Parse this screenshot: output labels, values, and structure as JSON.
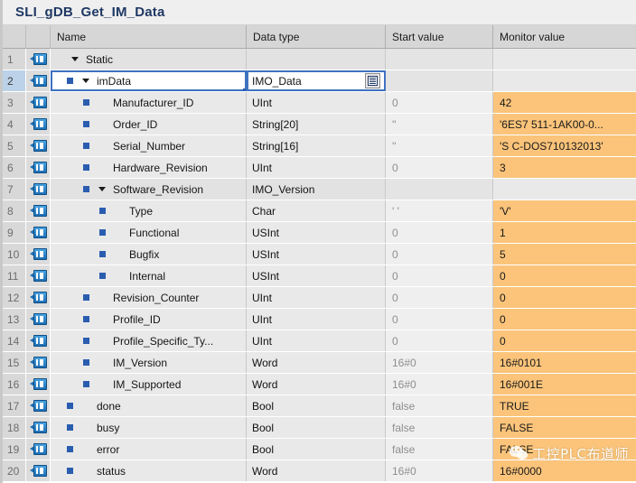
{
  "window": {
    "title": "SLI_gDB_Get_IM_Data"
  },
  "table": {
    "columns": {
      "number": "",
      "icon": "",
      "name": "Name",
      "data_type": "Data type",
      "start_value": "Start value",
      "monitor_value": "Monitor value"
    },
    "rows": [
      {
        "num": "1",
        "indent": 0,
        "expander": "down",
        "marker": false,
        "name": "Static",
        "type": "",
        "start": "",
        "monitor": "",
        "live": false,
        "group": true,
        "selected": false,
        "editing": false
      },
      {
        "num": "2",
        "indent": 1,
        "expander": "down",
        "marker": true,
        "name": "imData",
        "type": "IMO_Data",
        "start": "",
        "monitor": "",
        "live": false,
        "group": true,
        "selected": true,
        "editing": true
      },
      {
        "num": "3",
        "indent": 2,
        "expander": "none",
        "marker": true,
        "name": "Manufacturer_ID",
        "type": "UInt",
        "start": "0",
        "monitor": "42",
        "live": true,
        "group": false,
        "selected": false,
        "editing": false
      },
      {
        "num": "4",
        "indent": 2,
        "expander": "none",
        "marker": true,
        "name": "Order_ID",
        "type": "String[20]",
        "start": "''",
        "monitor": "'6ES7 511-1AK00-0...",
        "live": true,
        "group": false,
        "selected": false,
        "editing": false
      },
      {
        "num": "5",
        "indent": 2,
        "expander": "none",
        "marker": true,
        "name": "Serial_Number",
        "type": "String[16]",
        "start": "''",
        "monitor": "'S C-DOS710132013'",
        "live": true,
        "group": false,
        "selected": false,
        "editing": false
      },
      {
        "num": "6",
        "indent": 2,
        "expander": "none",
        "marker": true,
        "name": "Hardware_Revision",
        "type": "UInt",
        "start": "0",
        "monitor": "3",
        "live": true,
        "group": false,
        "selected": false,
        "editing": false
      },
      {
        "num": "7",
        "indent": 2,
        "expander": "down",
        "marker": true,
        "name": "Software_Revision",
        "type": "IMO_Version",
        "start": "",
        "monitor": "",
        "live": false,
        "group": true,
        "selected": false,
        "editing": false
      },
      {
        "num": "8",
        "indent": 3,
        "expander": "none",
        "marker": true,
        "name": "Type",
        "type": "Char",
        "start": "' '",
        "monitor": "'V'",
        "live": true,
        "group": false,
        "selected": false,
        "editing": false
      },
      {
        "num": "9",
        "indent": 3,
        "expander": "none",
        "marker": true,
        "name": "Functional",
        "type": "USInt",
        "start": "0",
        "monitor": "1",
        "live": true,
        "group": false,
        "selected": false,
        "editing": false
      },
      {
        "num": "10",
        "indent": 3,
        "expander": "none",
        "marker": true,
        "name": "Bugfix",
        "type": "USInt",
        "start": "0",
        "monitor": "5",
        "live": true,
        "group": false,
        "selected": false,
        "editing": false
      },
      {
        "num": "11",
        "indent": 3,
        "expander": "none",
        "marker": true,
        "name": "Internal",
        "type": "USInt",
        "start": "0",
        "monitor": "0",
        "live": true,
        "group": false,
        "selected": false,
        "editing": false
      },
      {
        "num": "12",
        "indent": 2,
        "expander": "none",
        "marker": true,
        "name": "Revision_Counter",
        "type": "UInt",
        "start": "0",
        "monitor": "0",
        "live": true,
        "group": false,
        "selected": false,
        "editing": false
      },
      {
        "num": "13",
        "indent": 2,
        "expander": "none",
        "marker": true,
        "name": "Profile_ID",
        "type": "UInt",
        "start": "0",
        "monitor": "0",
        "live": true,
        "group": false,
        "selected": false,
        "editing": false
      },
      {
        "num": "14",
        "indent": 2,
        "expander": "none",
        "marker": true,
        "name": "Profile_Specific_Ty...",
        "type": "UInt",
        "start": "0",
        "monitor": "0",
        "live": true,
        "group": false,
        "selected": false,
        "editing": false
      },
      {
        "num": "15",
        "indent": 2,
        "expander": "none",
        "marker": true,
        "name": "IM_Version",
        "type": "Word",
        "start": "16#0",
        "monitor": "16#0101",
        "live": true,
        "group": false,
        "selected": false,
        "editing": false
      },
      {
        "num": "16",
        "indent": 2,
        "expander": "none",
        "marker": true,
        "name": "IM_Supported",
        "type": "Word",
        "start": "16#0",
        "monitor": "16#001E",
        "live": true,
        "group": false,
        "selected": false,
        "editing": false
      },
      {
        "num": "17",
        "indent": 1,
        "expander": "none",
        "marker": true,
        "name": "done",
        "type": "Bool",
        "start": "false",
        "monitor": "TRUE",
        "live": true,
        "group": false,
        "selected": false,
        "editing": false
      },
      {
        "num": "18",
        "indent": 1,
        "expander": "none",
        "marker": true,
        "name": "busy",
        "type": "Bool",
        "start": "false",
        "monitor": "FALSE",
        "live": true,
        "group": false,
        "selected": false,
        "editing": false
      },
      {
        "num": "19",
        "indent": 1,
        "expander": "none",
        "marker": true,
        "name": "error",
        "type": "Bool",
        "start": "false",
        "monitor": "FALSE",
        "live": true,
        "group": false,
        "selected": false,
        "editing": false
      },
      {
        "num": "20",
        "indent": 1,
        "expander": "none",
        "marker": true,
        "name": "status",
        "type": "Word",
        "start": "16#0",
        "monitor": "16#0000",
        "live": true,
        "group": false,
        "selected": false,
        "editing": false
      }
    ]
  },
  "icons": {
    "row_tag": "plc-tag-icon",
    "type_picker": "type-list-picker-icon",
    "expander": "triangle-expander-icon"
  },
  "watermark": {
    "text": "工控PLC布道师",
    "icon": "wechat-icon"
  },
  "colors": {
    "title": "#1f3864",
    "monitor_live_bg": "#fbc47a",
    "marker_blue": "#2a5db0",
    "header_bg": "#d6d6d6",
    "row_bg": "#e9e9e9",
    "selection_blue": "#bcd2e8"
  }
}
